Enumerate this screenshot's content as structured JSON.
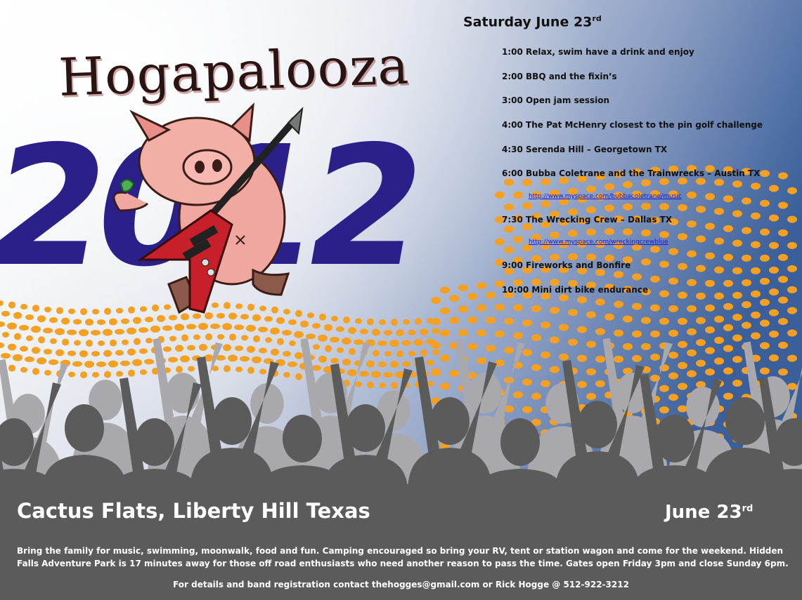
{
  "logo": {
    "title": "Hogapalooza",
    "year": "2012"
  },
  "schedule": {
    "heading": "Saturday June 23",
    "heading_suffix": "rd",
    "items": [
      "1:00 Relax, swim have a drink and enjoy",
      "2:00 BBQ and the fixin’s",
      "3:00 Open jam session",
      "4:00 The Pat McHenry closest to the pin golf challenge",
      "4:30 Serenda Hill – Georgetown TX",
      "6:00 Bubba Coletrane and the Trainwrecks – Austin TX",
      "7:30 The Wrecking Crew – Dallas TX",
      "9:00 Fireworks and Bonfire",
      "10:00 Mini dirt bike endurance"
    ],
    "links": [
      "http://www.myspace.com/bubbacoletrane/music",
      "http://www.myspace.com/wreckingcrewblue"
    ]
  },
  "footer": {
    "venue": "Cactus Flats, Liberty Hill Texas",
    "date": "June 23",
    "date_suffix": "rd",
    "description": "Bring the family for music, swimming, moonwalk, food and fun.  Camping encouraged so bring your RV, tent or station wagon and come for the weekend.  Hidden Falls Adventure Park is 17 minutes away for those off road enthusiasts who need another reason to pass the time.  Gates open Friday 3pm and close Sunday 6pm.",
    "contact": "For details and band registration contact thehogges@gmail.com or Rick Hogge @ 512-922-3212"
  },
  "colors": {
    "background_light": "#ffffff",
    "background_blue": "#3a5f9a",
    "year_blue": "#2b1f8a",
    "dots_orange": "#f5a021",
    "crowd_gray": "#5b5b5b",
    "pig_pink": "#f0a7a0",
    "guitar_red": "#c8202a"
  }
}
